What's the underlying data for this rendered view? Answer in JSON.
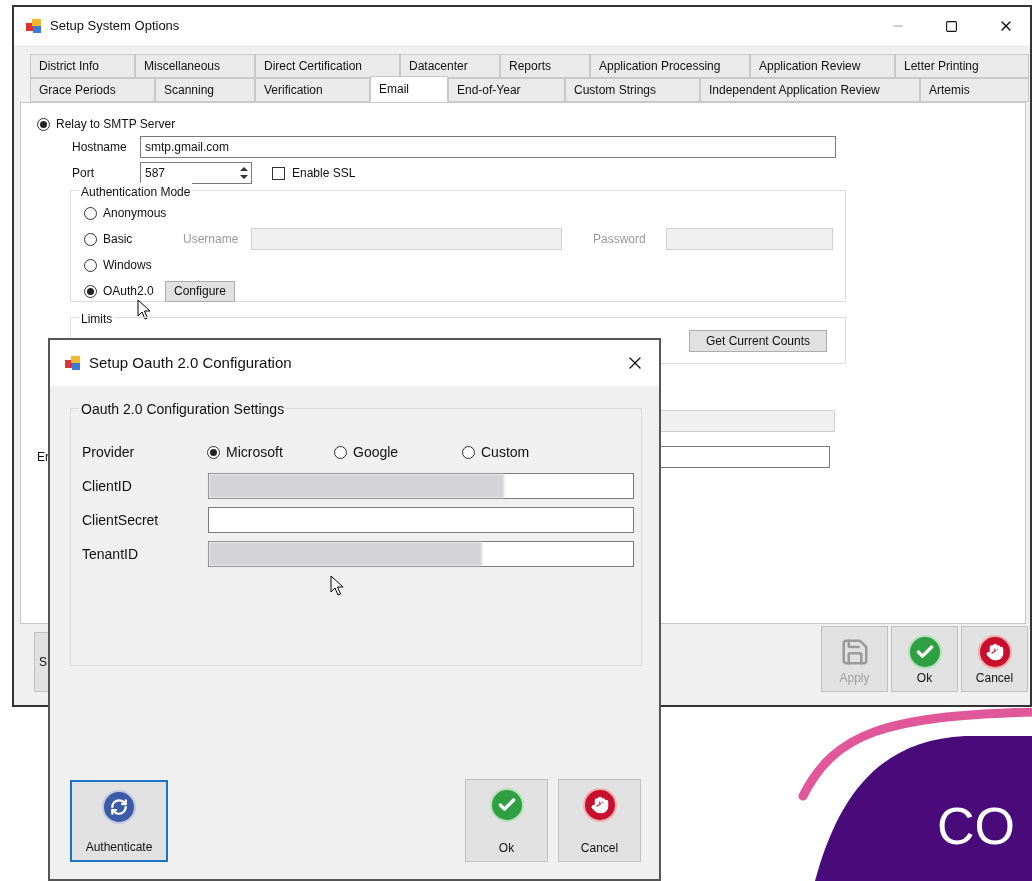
{
  "main_window": {
    "title": "Setup System Options",
    "tab_rows": [
      [
        {
          "label": "District Info",
          "selected": false
        },
        {
          "label": "Miscellaneous",
          "selected": false
        },
        {
          "label": "Direct Certification",
          "selected": false
        },
        {
          "label": "Datacenter",
          "selected": false
        },
        {
          "label": "Reports",
          "selected": false
        },
        {
          "label": "Application Processing",
          "selected": false
        },
        {
          "label": "Application Review",
          "selected": false
        },
        {
          "label": "Letter Printing",
          "selected": false
        }
      ],
      [
        {
          "label": "Grace Periods",
          "selected": false
        },
        {
          "label": "Scanning",
          "selected": false
        },
        {
          "label": "Verification",
          "selected": false
        },
        {
          "label": "Email",
          "selected": true
        },
        {
          "label": "End-of-Year",
          "selected": false
        },
        {
          "label": "Custom Strings",
          "selected": false
        },
        {
          "label": "Independent Application Review",
          "selected": false
        },
        {
          "label": "Artemis",
          "selected": false
        }
      ]
    ],
    "relay": {
      "label": "Relay to SMTP Server",
      "selected": true
    },
    "hostname": {
      "label": "Hostname",
      "value": "smtp.gmail.com"
    },
    "port": {
      "label": "Port",
      "value": "587"
    },
    "enable_ssl": {
      "label": "Enable SSL",
      "checked": false
    },
    "auth_mode": {
      "title": "Authentication Mode",
      "options": [
        {
          "label": "Anonymous",
          "selected": false
        },
        {
          "label": "Basic",
          "selected": false
        },
        {
          "label": "Windows",
          "selected": false
        },
        {
          "label": "OAuth2.0",
          "selected": true
        }
      ]
    },
    "username": {
      "label": "Username",
      "disabled": true
    },
    "password": {
      "label": "Password",
      "disabled": true
    },
    "configure_button": "Configure",
    "limits": {
      "title": "Limits",
      "button": "Get Current Counts"
    },
    "partial_label": "Er",
    "partial_button": "S",
    "buttons": [
      {
        "label": "Apply",
        "kind": "save",
        "disabled": true
      },
      {
        "label": "Ok",
        "kind": "ok",
        "disabled": false
      },
      {
        "label": "Cancel",
        "kind": "cancel",
        "disabled": false
      }
    ]
  },
  "dialog": {
    "title": "Setup Oauth 2.0 Configuration",
    "group_title": "Oauth 2.0 Configuration Settings",
    "provider": {
      "label": "Provider",
      "options": [
        {
          "label": "Microsoft",
          "selected": true
        },
        {
          "label": "Google",
          "selected": false
        },
        {
          "label": "Custom",
          "selected": false
        }
      ]
    },
    "fields": [
      {
        "label": "ClientID",
        "redacted": true
      },
      {
        "label": "ClientSecret",
        "redacted": false
      },
      {
        "label": "TenantID",
        "redacted": true
      }
    ],
    "buttons": [
      {
        "label": "Authenticate",
        "kind": "refresh",
        "focused": true
      },
      {
        "label": "Ok",
        "kind": "ok",
        "focused": false
      },
      {
        "label": "Cancel",
        "kind": "cancel",
        "focused": false
      }
    ]
  },
  "logo": {
    "text": "CO"
  }
}
